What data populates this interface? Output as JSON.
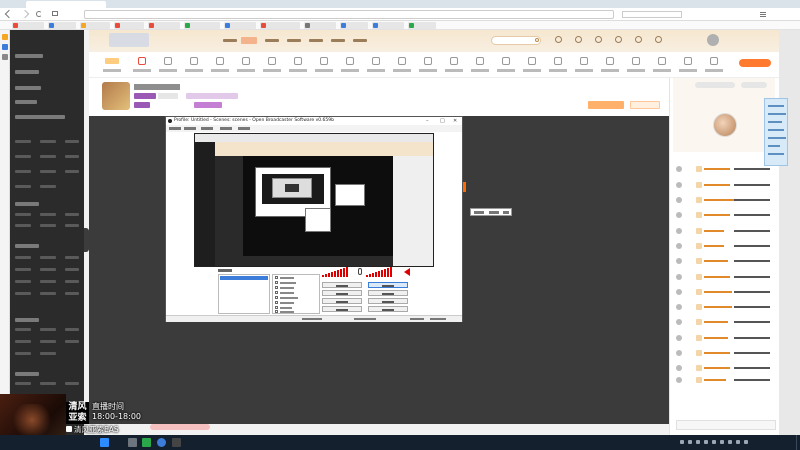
{
  "browser": {
    "tab_title": "",
    "address": "",
    "bookmarks": []
  },
  "obs": {
    "window_title": "Profile: Untitled - Scenes: scenes - Open Broadcaster Software v0.659b",
    "minimize_glyph": "–",
    "maximize_glyph": "□",
    "close_glyph": "✕"
  },
  "overlay": {
    "title_line1": "清风",
    "title_line2": "亚索",
    "schedule": "直播时间",
    "schedule_time": "18:00-18:00",
    "tiktok_handle": "清风亚索EAS",
    "fan_count": "616720"
  },
  "taskbar": {
    "clock_time": "",
    "clock_date": ""
  },
  "icons": {
    "obs": "obs-icon",
    "tiktok": "tiktok-icon",
    "windows": "windows-start-icon"
  },
  "colors": {
    "accent_orange": "#ff6b00",
    "header_beige": "#f6e7cf",
    "nav_dark": "#2b2b2b",
    "player_bg": "#3b3b3b",
    "taskbar": "#14202e"
  }
}
